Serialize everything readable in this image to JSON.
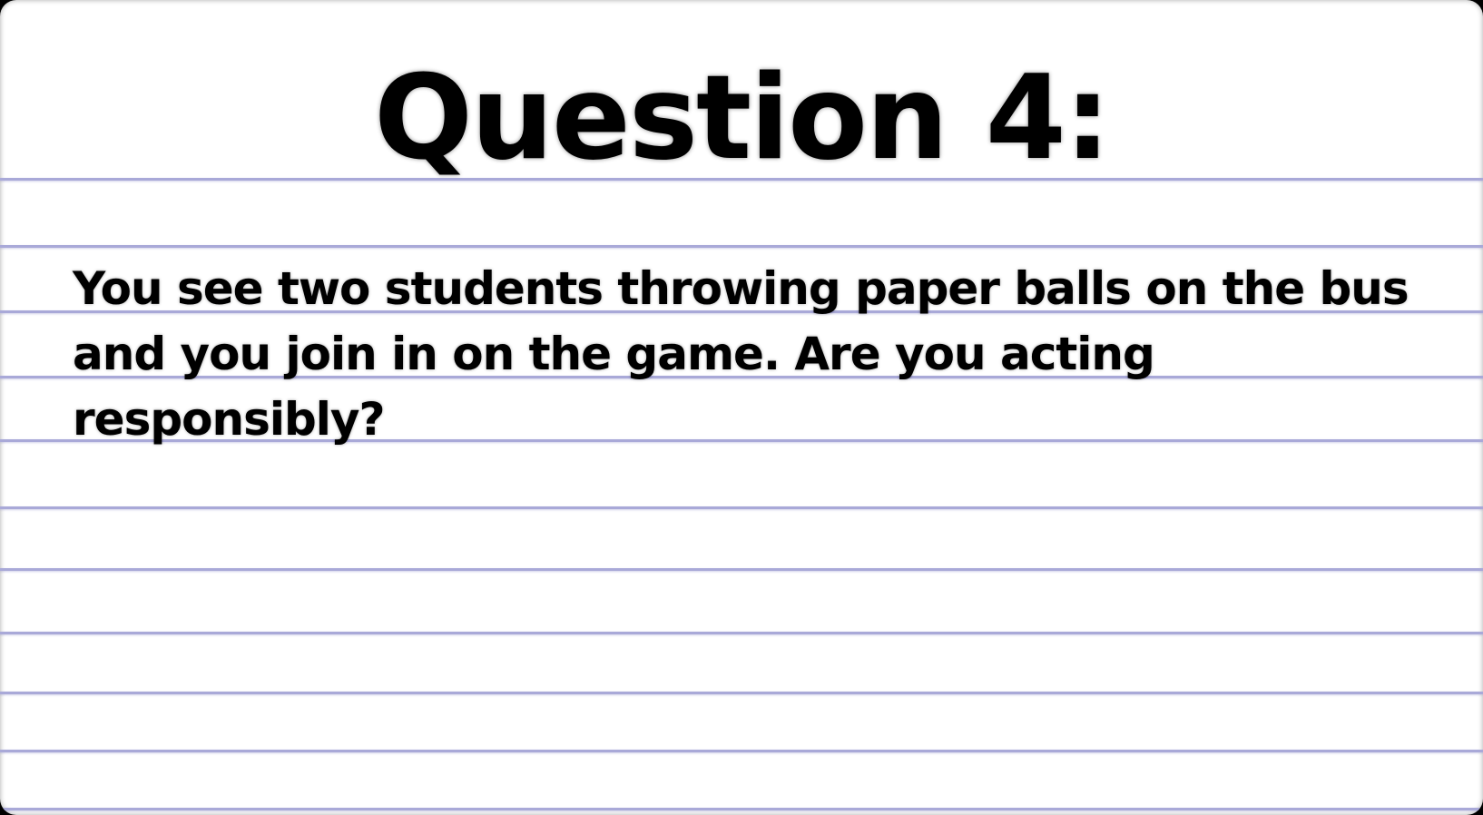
{
  "card": {
    "title": "Question 4:",
    "question_text": "You see two students throwing paper balls on the bus and you join in on the game. Are you acting responsibly?"
  },
  "colors": {
    "background": "#ffffff",
    "ruled_line": "#a9a9d8",
    "text": "#000000"
  }
}
